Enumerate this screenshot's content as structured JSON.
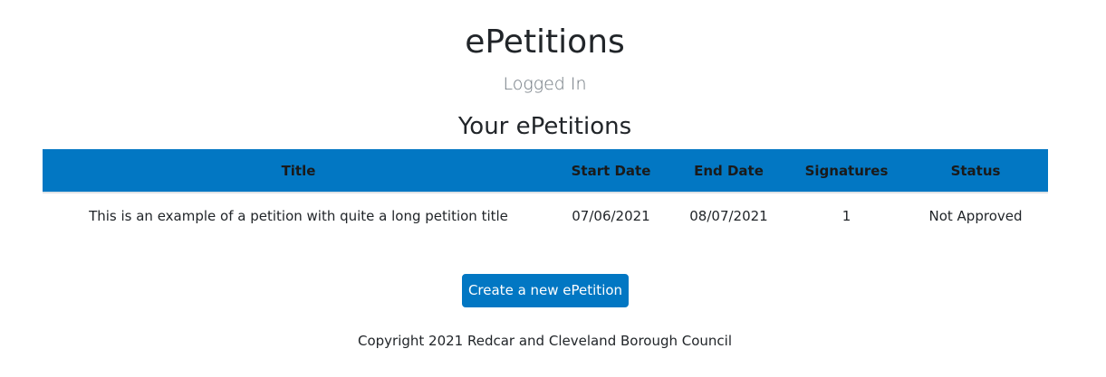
{
  "header": {
    "title": "ePetitions",
    "status": "Logged In"
  },
  "main": {
    "section_title": "Your ePetitions",
    "table": {
      "columns": [
        "Title",
        "Start Date",
        "End Date",
        "Signatures",
        "Status"
      ],
      "rows": [
        {
          "title": "This is an example of a petition with quite a long petition title",
          "start_date": "07/06/2021",
          "end_date": "08/07/2021",
          "signatures": "1",
          "status": "Not Approved"
        }
      ]
    },
    "create_button_label": "Create a new ePetition"
  },
  "footer": {
    "copyright": "Copyright 2021 Redcar and Cleveland Borough Council"
  },
  "colors": {
    "accent": "#0277c3",
    "text": "#212529",
    "muted": "#6c757d"
  }
}
